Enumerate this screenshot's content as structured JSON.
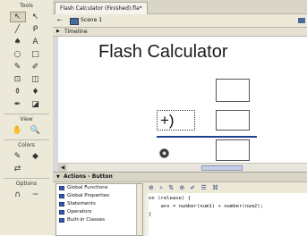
{
  "tools": {
    "header": "Tools",
    "view_label": "View",
    "colors_label": "Colors",
    "options_label": "Options",
    "items": [
      {
        "name": "arrow-tool-icon",
        "glyph": "↖"
      },
      {
        "name": "subselect-tool-icon",
        "glyph": "↖"
      },
      {
        "name": "line-tool-icon",
        "glyph": "╱"
      },
      {
        "name": "lasso-tool-icon",
        "glyph": "ᑭ"
      },
      {
        "name": "pen-tool-icon",
        "glyph": "♠"
      },
      {
        "name": "text-tool-icon",
        "glyph": "A"
      },
      {
        "name": "oval-tool-icon",
        "glyph": "○"
      },
      {
        "name": "rectangle-tool-icon",
        "glyph": "□"
      },
      {
        "name": "pencil-tool-icon",
        "glyph": "✎"
      },
      {
        "name": "brush-tool-icon",
        "glyph": "✐"
      },
      {
        "name": "free-transform-tool-icon",
        "glyph": "⊡"
      },
      {
        "name": "fill-transform-tool-icon",
        "glyph": "◫"
      },
      {
        "name": "ink-bottle-tool-icon",
        "glyph": "⚱"
      },
      {
        "name": "paint-bucket-tool-icon",
        "glyph": "♦"
      },
      {
        "name": "eyedropper-tool-icon",
        "glyph": "✒"
      },
      {
        "name": "eraser-tool-icon",
        "glyph": "◪"
      }
    ],
    "view_items": [
      {
        "name": "hand-tool-icon",
        "glyph": "✋"
      },
      {
        "name": "zoom-tool-icon",
        "glyph": "🔍"
      }
    ],
    "color_items": [
      {
        "name": "stroke-color-icon",
        "glyph": "✎"
      },
      {
        "name": "fill-color-icon",
        "glyph": "◆"
      },
      {
        "name": "swap-colors-icon",
        "glyph": "⇄"
      }
    ],
    "option_items": [
      {
        "name": "snap-magnet-icon",
        "glyph": "∩"
      },
      {
        "name": "smooth-icon",
        "glyph": "~"
      }
    ]
  },
  "document": {
    "tab_title": "Flash Calculator (Finished).fla*",
    "scene_label": "Scene 1",
    "back_arrow": "←",
    "timeline_label": "Timeline",
    "stage_title": "Flash Calculator",
    "operator_text": "+)",
    "button_glyph": "◉"
  },
  "actions": {
    "header": "Actions - Button",
    "list": [
      "Global Functions",
      "Global Properties",
      "Statements",
      "Operators",
      "Built-in Classes"
    ],
    "toolbar_icons": "⊕ ⌕ ⇅ ⊕ ✔ ☰ ⌘",
    "code_lines": [
      "on (release) {",
      "    ans = number(num1) + number(num2);",
      "}"
    ]
  }
}
